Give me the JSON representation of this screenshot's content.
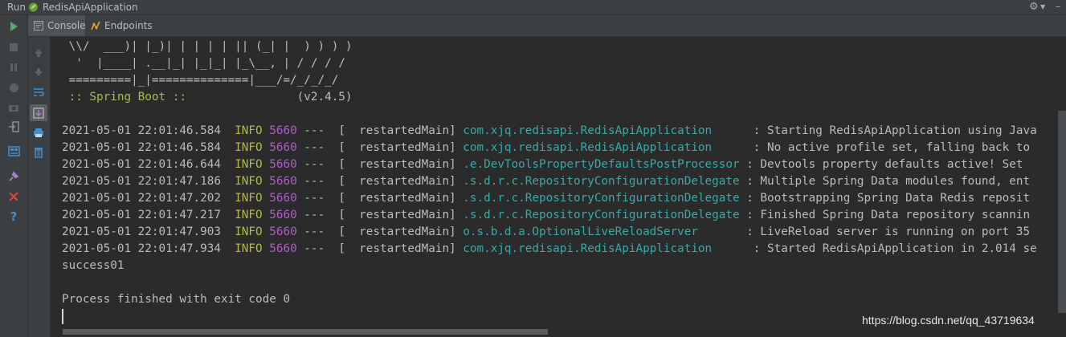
{
  "titlebar": {
    "run_label": "Run",
    "app_name": "RedisApiApplication",
    "icons": [
      "spring-leaf-icon",
      "gear-icon",
      "minimize-icon"
    ]
  },
  "tabs": [
    {
      "label": "Console",
      "icon": "console-icon",
      "active": true
    },
    {
      "label": "Endpoints",
      "icon": "endpoints-icon",
      "active": false
    }
  ],
  "left_toolbar_icons": [
    "run-icon",
    "stop-icon",
    "pause-icon",
    "debug-icon",
    "camera-icon",
    "exit-icon",
    "layout-icon",
    "pin-icon",
    "close-icon",
    "help-icon"
  ],
  "console_toolbar_icons": [
    "up-arrow-icon",
    "down-arrow-icon",
    "soft-wrap-icon",
    "scroll-to-end-icon",
    "print-icon",
    "trash-icon"
  ],
  "colors": {
    "background": "#2b2b2b",
    "panel": "#3c3f41",
    "info": "#b7b746",
    "pid": "#b05cc9",
    "logger": "#3ba8a8",
    "spring": "#9ac14a"
  },
  "banner": [
    " \\\\/  ___)| |_)| | | | | || (_| |  ) ) ) )",
    "  '  |____| .__|_| |_|_| |_\\__, | / / / /",
    " =========|_|==============|___/=/_/_/_/"
  ],
  "spring_boot": {
    "label": " :: Spring Boot :: ",
    "version": "               (v2.4.5)"
  },
  "log_lines": [
    {
      "timestamp": "2021-05-01 22:01:46.584",
      "level": "INFO",
      "pid": "5660",
      "thread": "---  [  restartedMain]",
      "logger": "com.xjq.redisapi.RedisApiApplication      ",
      "message": ": Starting RedisApiApplication using Java"
    },
    {
      "timestamp": "2021-05-01 22:01:46.584",
      "level": "INFO",
      "pid": "5660",
      "thread": "---  [  restartedMain]",
      "logger": "com.xjq.redisapi.RedisApiApplication      ",
      "message": ": No active profile set, falling back to"
    },
    {
      "timestamp": "2021-05-01 22:01:46.644",
      "level": "INFO",
      "pid": "5660",
      "thread": "---  [  restartedMain]",
      "logger": ".e.DevToolsPropertyDefaultsPostProcessor",
      "message": " : Devtools property defaults active! Set"
    },
    {
      "timestamp": "2021-05-01 22:01:47.186",
      "level": "INFO",
      "pid": "5660",
      "thread": "---  [  restartedMain]",
      "logger": ".s.d.r.c.RepositoryConfigurationDelegate",
      "message": " : Multiple Spring Data modules found, ent"
    },
    {
      "timestamp": "2021-05-01 22:01:47.202",
      "level": "INFO",
      "pid": "5660",
      "thread": "---  [  restartedMain]",
      "logger": ".s.d.r.c.RepositoryConfigurationDelegate",
      "message": " : Bootstrapping Spring Data Redis reposit"
    },
    {
      "timestamp": "2021-05-01 22:01:47.217",
      "level": "INFO",
      "pid": "5660",
      "thread": "---  [  restartedMain]",
      "logger": ".s.d.r.c.RepositoryConfigurationDelegate",
      "message": " : Finished Spring Data repository scannin"
    },
    {
      "timestamp": "2021-05-01 22:01:47.903",
      "level": "INFO",
      "pid": "5660",
      "thread": "---  [  restartedMain]",
      "logger": "o.s.b.d.a.OptionalLiveReloadServer       ",
      "message": ": LiveReload server is running on port 35"
    },
    {
      "timestamp": "2021-05-01 22:01:47.934",
      "level": "INFO",
      "pid": "5660",
      "thread": "---  [  restartedMain]",
      "logger": "com.xjq.redisapi.RedisApiApplication      ",
      "message": ": Started RedisApiApplication in 2.014 se"
    }
  ],
  "output_line": "success01",
  "process_line": "Process finished with exit code 0",
  "watermark": "https://blog.csdn.net/qq_43719634"
}
